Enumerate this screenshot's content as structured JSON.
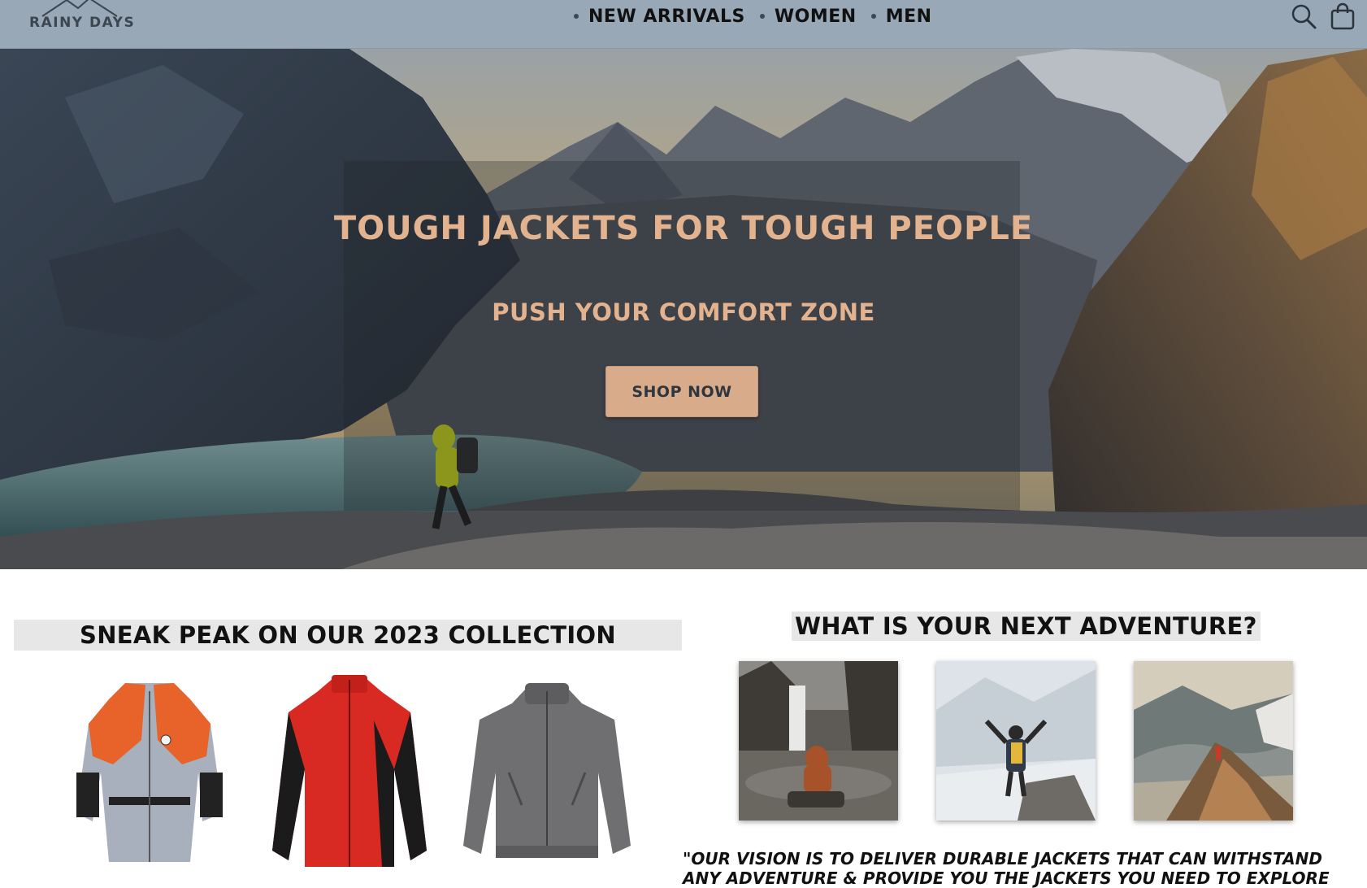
{
  "header": {
    "logo_text": "RAINY DAYS",
    "nav": [
      {
        "label": "NEW ARRIVALS"
      },
      {
        "label": "WOMEN"
      },
      {
        "label": "MEN"
      }
    ],
    "icons": [
      "search-icon",
      "shopping-bag-icon"
    ]
  },
  "hero": {
    "title": "TOUGH JACKETS FOR TOUGH PEOPLE",
    "subtitle": "PUSH YOUR COMFORT ZONE",
    "cta_label": "SHOP NOW"
  },
  "collection": {
    "heading": "SNEAK PEAK ON OUR 2023 COLLECTION"
  },
  "adventure": {
    "heading": "WHAT IS YOUR NEXT ADVENTURE?",
    "vision_text": "\"OUR VISION IS TO DELIVER DURABLE JACKETS THAT CAN WITHSTAND ANY ADVENTURE & PROVIDE YOU THE JACKETS YOU NEED TO EXPLORE THE"
  },
  "colors": {
    "header_bg": "#98a8b6",
    "accent": "#e2b38e",
    "button_bg": "#d8ab8a",
    "button_text": "#2e3640"
  }
}
